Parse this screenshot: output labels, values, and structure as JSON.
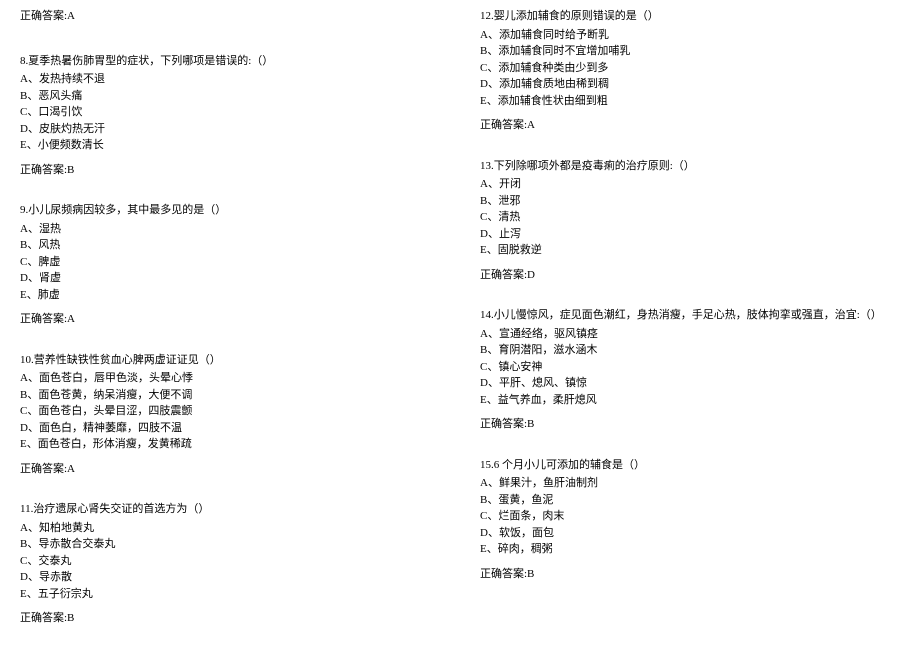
{
  "left": {
    "top_answer": "正确答案:A",
    "questions": [
      {
        "stem": "8.夏季热暑伤肺胃型的症状，下列哪项是错误的:（）",
        "options": [
          "A、发热持续不退",
          "B、恶风头痛",
          "C、口渴引饮",
          "D、皮肤灼热无汗",
          "E、小便频数清长"
        ],
        "answer": "正确答案:B"
      },
      {
        "stem": "9.小儿尿频病因较多，其中最多见的是（）",
        "options": [
          "A、湿热",
          "B、风热",
          "C、脾虚",
          "D、肾虚",
          "E、肺虚"
        ],
        "answer": "正确答案:A"
      },
      {
        "stem": "10.营养性缺铁性贫血心脾两虚证证见（）",
        "options": [
          "A、面色苍白，唇甲色淡，头晕心悸",
          "B、面色苍黄，纳呆消瘦，大便不调",
          "C、面色苍白，头晕目涩，四肢震颤",
          "D、面色白，精神萎靡，四肢不温",
          "E、面色苍白，形体消瘦，发黄稀疏"
        ],
        "answer": "正确答案:A"
      },
      {
        "stem": "11.治疗遗尿心肾失交证的首选方为（）",
        "options": [
          "A、知柏地黄丸",
          "B、导赤散合交泰丸",
          "C、交泰丸",
          "D、导赤散",
          "E、五子衍宗丸"
        ],
        "answer": "正确答案:B"
      }
    ]
  },
  "right": {
    "questions": [
      {
        "stem": "12.婴儿添加辅食的原则错误的是（）",
        "options": [
          "A、添加辅食同时给予断乳",
          "B、添加辅食同时不宜增加哺乳",
          "C、添加辅食种类由少到多",
          "D、添加辅食质地由稀到稠",
          "E、添加辅食性状由细到粗"
        ],
        "answer": "正确答案:A"
      },
      {
        "stem": "13.下列除哪项外都是疫毒痢的治疗原则:（）",
        "options": [
          "A、开闭",
          "B、泄邪",
          "C、清热",
          "D、止泻",
          "E、固脱救逆"
        ],
        "answer": "正确答案:D"
      },
      {
        "stem": "14.小儿慢惊风，症见面色潮红，身热消瘦，手足心热，肢体拘挛或强直，治宜:（）",
        "options": [
          "A、宣通经络，驱风镇痉",
          "B、育阴潜阳，滋水涵木",
          "C、镇心安神",
          "D、平肝、熄风、镇惊",
          "E、益气养血，柔肝熄风"
        ],
        "answer": "正确答案:B"
      },
      {
        "stem": "15.6 个月小儿可添加的辅食是（）",
        "options": [
          "A、鲜果汁，鱼肝油制剂",
          "B、蛋黄，鱼泥",
          "C、烂面条，肉末",
          "D、软饭，面包",
          "E、碎肉，稠粥"
        ],
        "answer": "正确答案:B"
      }
    ]
  }
}
